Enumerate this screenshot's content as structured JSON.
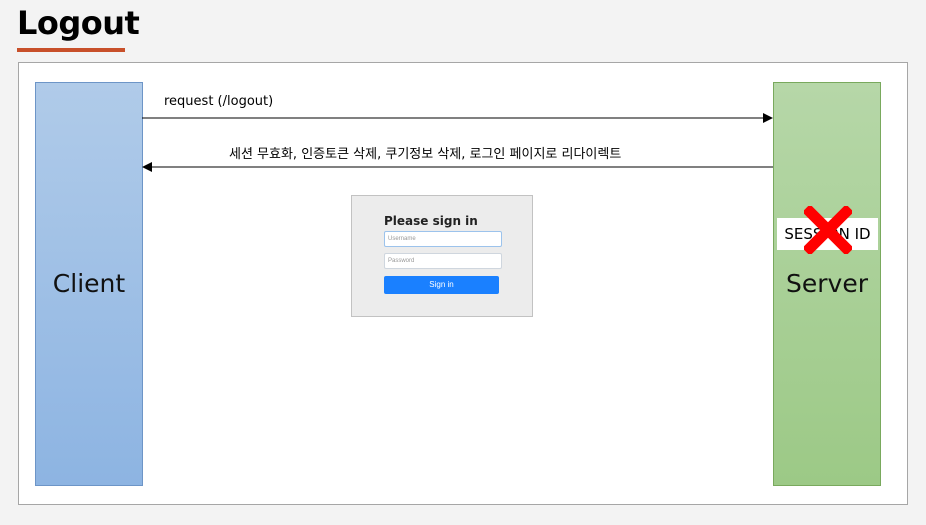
{
  "page": {
    "title": "Logout",
    "accent_color": "#c8502a"
  },
  "client": {
    "label": "Client"
  },
  "server": {
    "label": "Server",
    "session_label": "SESSION ID"
  },
  "arrows": {
    "request_label": "request (/logout)",
    "response_label": "세션 무효화,  인증토큰 삭제, 쿠기정보 삭제, 로그인 페이지로 리다이렉트"
  },
  "login_form": {
    "heading": "Please sign in",
    "username_placeholder": "Username",
    "password_placeholder": "Password",
    "button_label": "Sign in"
  },
  "icons": {
    "session_removed": "cross-icon"
  }
}
